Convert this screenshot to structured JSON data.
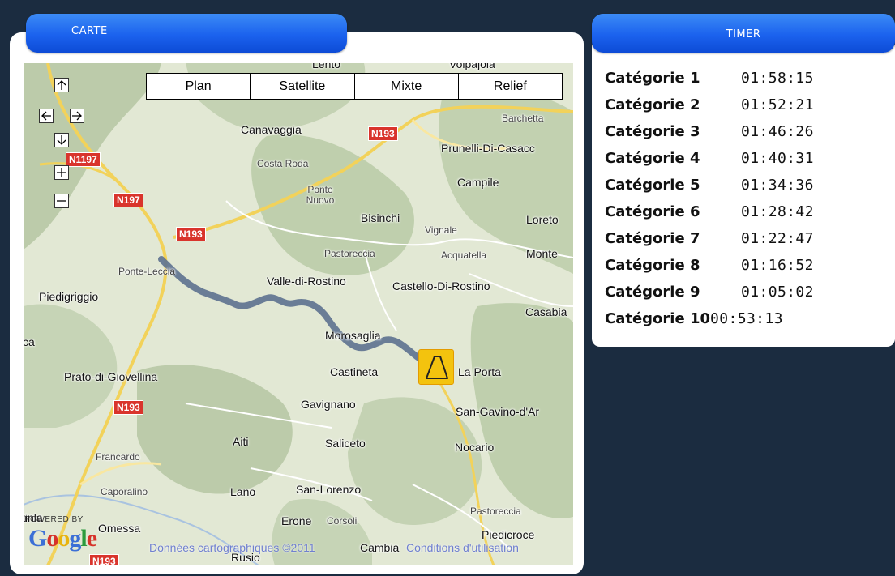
{
  "map_panel": {
    "tab_label": "CARTE",
    "map_types": [
      "Plan",
      "Satellite",
      "Mixte",
      "Relief"
    ],
    "places": [
      {
        "name": "Canavaggia"
      },
      {
        "name": "Costa Roda"
      },
      {
        "name": "Barchetta"
      },
      {
        "name": "Prunelli-Di-Casacc"
      },
      {
        "name": "Campile"
      },
      {
        "name": "Ponte Nuovo"
      },
      {
        "name": "Bisinchi"
      },
      {
        "name": "Vignale"
      },
      {
        "name": "Loreto"
      },
      {
        "name": "Pastoreccia"
      },
      {
        "name": "Acquatella"
      },
      {
        "name": "Monte"
      },
      {
        "name": "Ponte-Leccia"
      },
      {
        "name": "Valle-di-Rostino"
      },
      {
        "name": "Castello-Di-Rostino"
      },
      {
        "name": "Piedigriggio"
      },
      {
        "name": "Casabia"
      },
      {
        "name": "Morosaglia"
      },
      {
        "name": "ca"
      },
      {
        "name": "Castineta"
      },
      {
        "name": "La Porta"
      },
      {
        "name": "Prato-di-Giovellina"
      },
      {
        "name": "Gavignano"
      },
      {
        "name": "San-Gavino-d'Ar"
      },
      {
        "name": "Aiti"
      },
      {
        "name": "Saliceto"
      },
      {
        "name": "Nocario"
      },
      {
        "name": "Francardo"
      },
      {
        "name": "Caporalino"
      },
      {
        "name": "Lano"
      },
      {
        "name": "San-Lorenzo"
      },
      {
        "name": "Pastoreccia"
      },
      {
        "name": "tinla"
      },
      {
        "name": "Omessa"
      },
      {
        "name": "Erone"
      },
      {
        "name": "Corsoli"
      },
      {
        "name": "Piedicroce"
      },
      {
        "name": "Rusio"
      },
      {
        "name": "Cambia"
      },
      {
        "name": "Lento"
      },
      {
        "name": "Volpajola"
      }
    ],
    "roads": [
      "N193",
      "N1197",
      "N197",
      "N193",
      "N193",
      "N193"
    ],
    "powered_by": "POWERED BY",
    "google_logo": [
      "G",
      "o",
      "o",
      "g",
      "l",
      "e"
    ],
    "map_data_text": "Données cartographiques ©2011",
    "terms_text": "Conditions d'utilisation",
    "colors": {
      "tab_blue": "#1b62ee",
      "route": "#5f7390",
      "marker": "#f3c30e",
      "road_shield": "#d9342c"
    },
    "icons": [
      "pan-up-icon",
      "pan-left-icon",
      "pan-right-icon",
      "pan-down-icon",
      "zoom-in-icon",
      "zoom-out-icon",
      "mountain-marker-icon"
    ]
  },
  "timer_panel": {
    "tab_label": "TIMER",
    "rows": [
      {
        "category": "Catégorie 1",
        "time": "01:58:15"
      },
      {
        "category": "Catégorie 2",
        "time": "01:52:21"
      },
      {
        "category": "Catégorie 3",
        "time": "01:46:26"
      },
      {
        "category": "Catégorie 4",
        "time": "01:40:31"
      },
      {
        "category": "Catégorie 5",
        "time": "01:34:36"
      },
      {
        "category": "Catégorie 6",
        "time": "01:28:42"
      },
      {
        "category": "Catégorie 7",
        "time": "01:22:47"
      },
      {
        "category": "Catégorie 8",
        "time": "01:16:52"
      },
      {
        "category": "Catégorie 9",
        "time": "01:05:02"
      },
      {
        "category": "Catégorie 10",
        "time": "00:53:13"
      }
    ]
  }
}
